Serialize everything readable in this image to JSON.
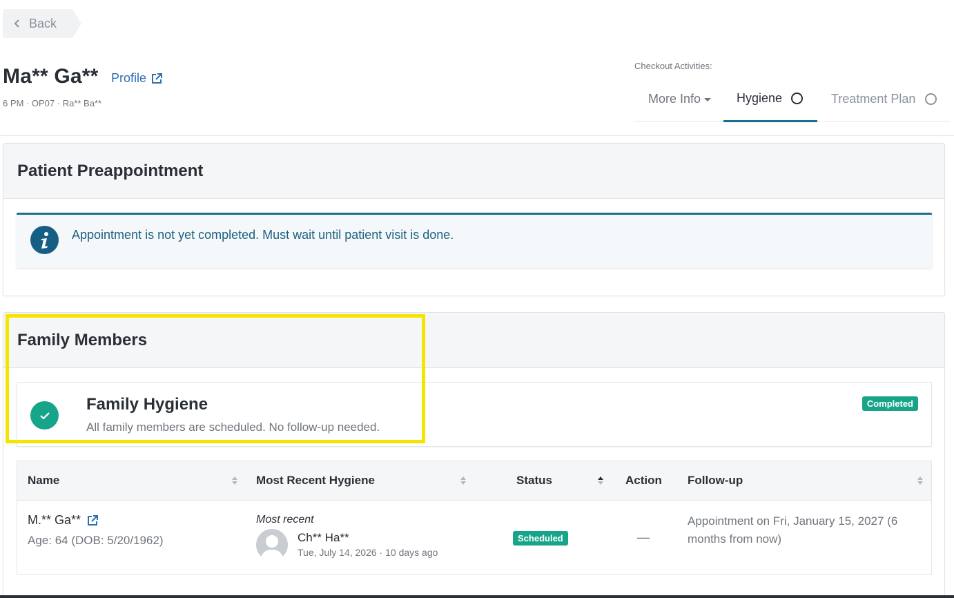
{
  "nav": {
    "back_label": "Back"
  },
  "patient": {
    "name": "Ma** Ga**",
    "profile_label": "Profile",
    "subline": "6 PM · OP07 · Ra** Ba**"
  },
  "checkout": {
    "label": "Checkout Activities:",
    "tabs": [
      {
        "label": "More Info"
      },
      {
        "label": "Hygiene"
      },
      {
        "label": "Treatment Plan"
      }
    ]
  },
  "preappointment": {
    "title": "Patient Preappointment",
    "message": "Appointment is not yet completed. Must wait until patient visit is done."
  },
  "family": {
    "title": "Family Members",
    "hygiene_title": "Family Hygiene",
    "hygiene_sub": "All family members are scheduled. No follow-up needed.",
    "hygiene_badge": "Completed",
    "columns": [
      "Name",
      "Most Recent Hygiene",
      "Status",
      "Action",
      "Follow-up"
    ],
    "rows": [
      {
        "name": "M.** Ga**",
        "age": "Age: 64 (DOB: 5/20/1962)",
        "recent_label": "Most recent",
        "provider": "Ch** Ha**",
        "date": "Tue, July 14, 2026 · 10 days ago",
        "status": "Scheduled",
        "action": "—",
        "followup": "Appointment on Fri, January 15, 2027 (6 months from now)"
      }
    ]
  },
  "colors": {
    "accent": "#1d6f8f",
    "success": "#17a58a",
    "link": "#2c6fb5",
    "highlight": "#f7e300"
  }
}
